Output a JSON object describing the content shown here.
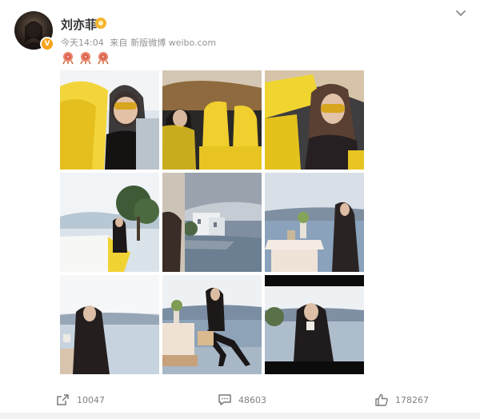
{
  "post": {
    "author": "刘亦菲",
    "time": "今天14:04",
    "source_prefix": "来自",
    "source": "新版微博 weibo.com",
    "verified_badge": "V",
    "emojis": [
      "rose-emoji",
      "rose-emoji",
      "rose-emoji"
    ]
  },
  "photos": [
    {
      "name": "photo-yellow-car-sunglasses"
    },
    {
      "name": "photo-yellow-car-seats"
    },
    {
      "name": "photo-yellow-car-portrait"
    },
    {
      "name": "photo-car-lakeside"
    },
    {
      "name": "photo-lake-house"
    },
    {
      "name": "photo-lakeside-table"
    },
    {
      "name": "photo-drinking-lake"
    },
    {
      "name": "photo-table-chair-lake"
    },
    {
      "name": "photo-drinking-closeup"
    }
  ],
  "actions": {
    "share_count": "10047",
    "comment_count": "48603",
    "like_count": "178267"
  },
  "colors": {
    "accent_badge": "#f7a21b",
    "meta_text": "#939393",
    "action_text": "#808080"
  }
}
